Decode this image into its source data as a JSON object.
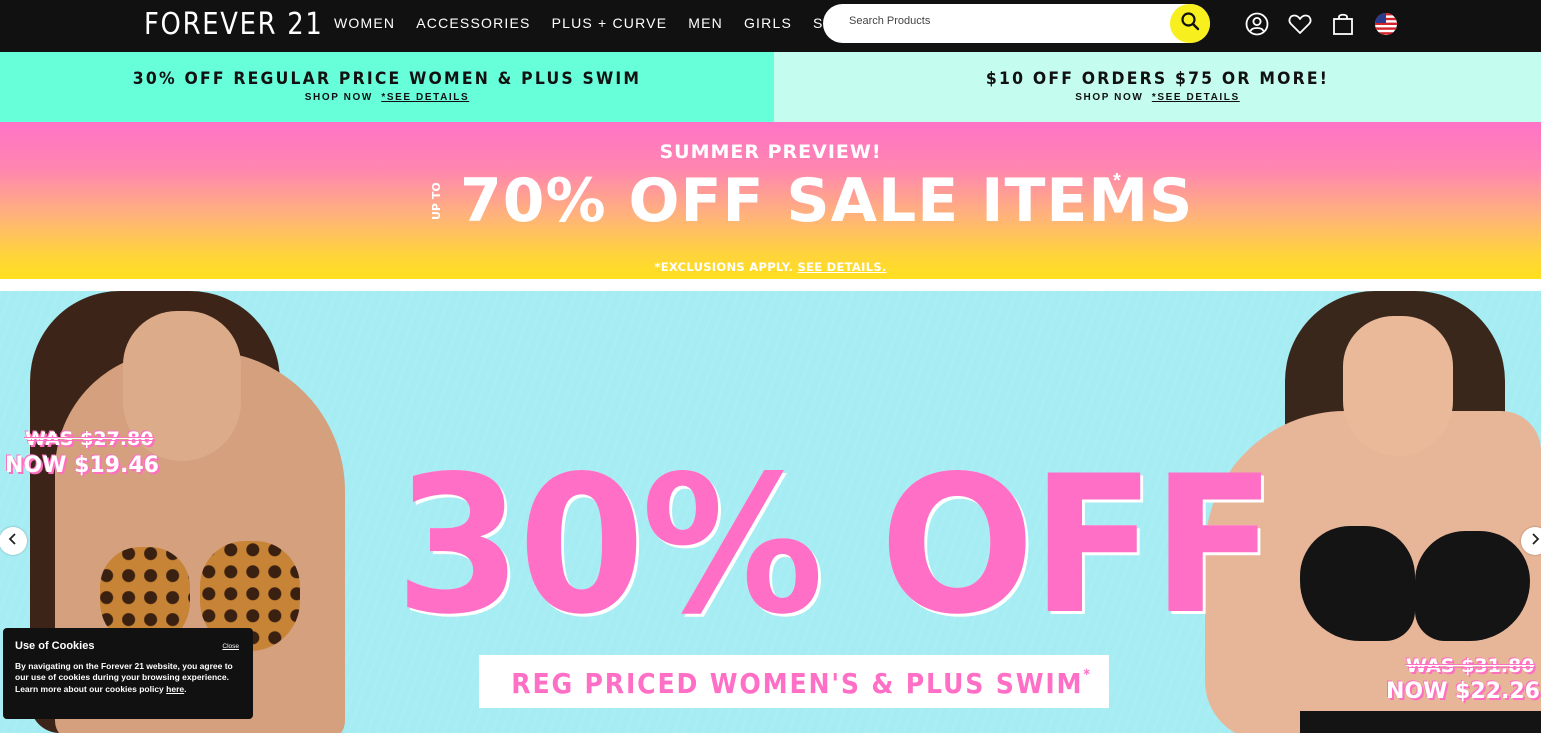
{
  "header": {
    "logo": "FOREVER 21",
    "nav": [
      "WOMEN",
      "ACCESSORIES",
      "PLUS + CURVE",
      "MEN",
      "GIRLS",
      "SALE"
    ],
    "search_placeholder": "Search Products"
  },
  "promos": [
    {
      "title": "30% OFF REGULAR PRICE WOMEN & PLUS SWIM",
      "shop": "SHOP NOW",
      "details": "*SEE DETAILS"
    },
    {
      "title": "$10 OFF ORDERS $75 OR MORE!",
      "shop": "SHOP NOW",
      "details": "*SEE DETAILS"
    }
  ],
  "summer_banner": {
    "preheader": "SUMMER PREVIEW!",
    "up_to": "UP TO",
    "headline": "70% OFF SALE ITEMS",
    "star": "*",
    "exclusions": "*EXCLUSIONS APPLY.",
    "see_details": "SEE DETAILS."
  },
  "swim_hero": {
    "left_price": {
      "was": "WAS $27.80",
      "now": "NOW $19.46"
    },
    "right_price": {
      "was": "WAS $31.80",
      "now": "NOW $22.26"
    },
    "headline": "30% OFF",
    "subline": "REG PRICED WOMEN'S & PLUS SWIM",
    "subline_star": "*"
  },
  "cookie": {
    "title": "Use of Cookies",
    "close": "Close",
    "body": "By navigating on the Forever 21 website, you agree to our use of cookies during your browsing experience. Learn more about our cookies policy",
    "link": "here",
    "end": "."
  },
  "colors": {
    "header_bg": "#111111",
    "promo_left": "#66ffda",
    "promo_right": "#c4fdef",
    "search_button": "#f8ef1e",
    "hero_pink": "#ff6fc6",
    "hero_bg": "#a5ecf3"
  },
  "icons": [
    "search-icon",
    "account-icon",
    "heart-icon",
    "bag-icon",
    "us-flag-icon",
    "chevron-left-icon",
    "chevron-right-icon"
  ]
}
